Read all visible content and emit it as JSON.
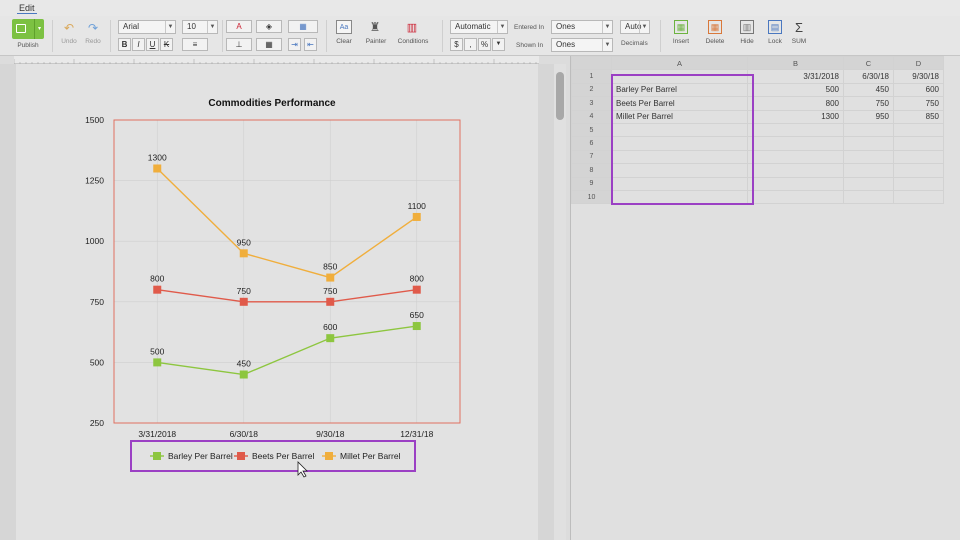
{
  "menu": {
    "edit": "Edit"
  },
  "toolbar": {
    "publish": "Publish",
    "undo": "Undo",
    "redo": "Redo",
    "font_name": "Arial",
    "font_size": "10",
    "clear": "Clear",
    "painter": "Painter",
    "conditions": "Conditions",
    "number_format": "Automatic",
    "entered_in_label": "Entered In",
    "entered_in_value": "Ones",
    "shown_in_label": "Shown In",
    "shown_in_value": "Ones",
    "decimals_value": "Auto",
    "decimals_label": "Decimals",
    "insert": "Insert",
    "delete": "Delete",
    "hide": "Hide",
    "lock": "Lock",
    "sum": "SUM",
    "bold": "B",
    "italic": "I",
    "underline": "U",
    "strike": "K",
    "dollar": "$",
    "comma": ",",
    "percent": "%"
  },
  "chart_data": {
    "type": "line",
    "title": "Commodities Performance",
    "categories": [
      "3/31/2018",
      "6/30/18",
      "9/30/18",
      "12/31/18"
    ],
    "ylim": [
      250,
      1500
    ],
    "yticks": [
      "1500",
      "1250",
      "1000",
      "750",
      "500",
      "250"
    ],
    "grid": true,
    "legend": "bottom",
    "series": [
      {
        "name": "Barley Per Barrel",
        "values": [
          500,
          450,
          600,
          650
        ],
        "color": "#8dc63f"
      },
      {
        "name": "Beets Per Barrel",
        "values": [
          800,
          750,
          750,
          800
        ],
        "color": "#e05a4a"
      },
      {
        "name": "Millet Per Barrel",
        "values": [
          1300,
          950,
          850,
          1100
        ],
        "color": "#f0ae3c"
      }
    ]
  },
  "grid": {
    "columns": [
      "A",
      "B",
      "C",
      "D"
    ],
    "rows": [
      {
        "num": "1",
        "cells": [
          "",
          "3/31/2018",
          "6/30/18",
          "9/30/18"
        ]
      },
      {
        "num": "2",
        "cells": [
          "Barley Per Barrel",
          "500",
          "450",
          "600"
        ]
      },
      {
        "num": "3",
        "cells": [
          "Beets Per Barrel",
          "800",
          "750",
          "750"
        ]
      },
      {
        "num": "4",
        "cells": [
          "Millet Per Barrel",
          "1300",
          "950",
          "850"
        ]
      },
      {
        "num": "5",
        "cells": [
          "",
          "",
          "",
          ""
        ]
      },
      {
        "num": "6",
        "cells": [
          "",
          "",
          "",
          ""
        ]
      },
      {
        "num": "7",
        "cells": [
          "",
          "",
          "",
          ""
        ]
      },
      {
        "num": "8",
        "cells": [
          "",
          "",
          "",
          ""
        ]
      },
      {
        "num": "9",
        "cells": [
          "",
          "",
          "",
          ""
        ]
      },
      {
        "num": "10",
        "cells": [
          "",
          "",
          "",
          ""
        ]
      }
    ]
  },
  "colors": {
    "highlight": "#9b40c4",
    "accent_green": "#6db33f"
  }
}
